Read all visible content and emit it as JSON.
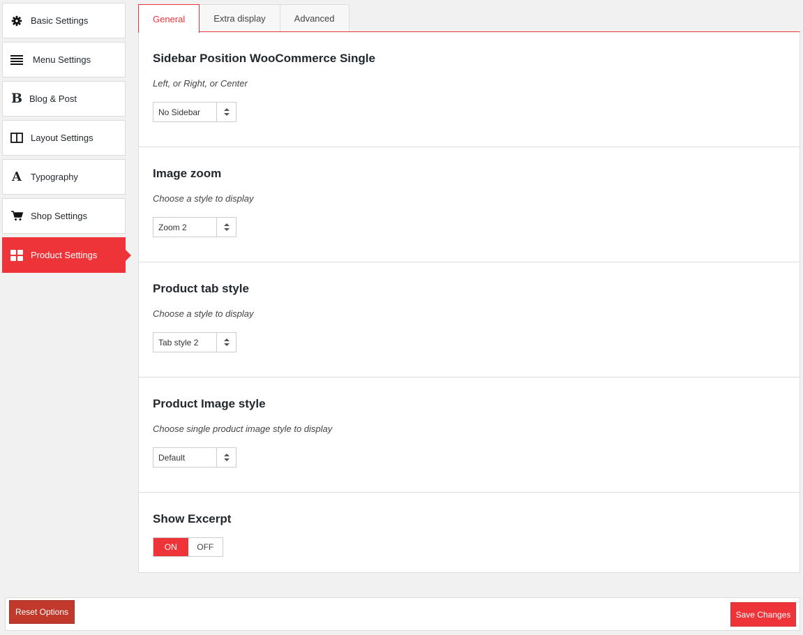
{
  "sidebar": {
    "items": [
      {
        "label": "Basic Settings",
        "icon": "gear-icon"
      },
      {
        "label": "Menu Settings",
        "icon": "list-icon"
      },
      {
        "label": "Blog & Post",
        "icon": "bold-b-icon",
        "glyph": "B"
      },
      {
        "label": "Layout Settings",
        "icon": "columns-icon"
      },
      {
        "label": "Typography",
        "icon": "font-a-icon",
        "glyph": "A"
      },
      {
        "label": "Shop Settings",
        "icon": "cart-icon"
      },
      {
        "label": "Product Settings",
        "icon": "grid-icon",
        "active": true
      }
    ]
  },
  "tabs": [
    {
      "label": "General",
      "active": true
    },
    {
      "label": "Extra display"
    },
    {
      "label": "Advanced"
    }
  ],
  "sections": [
    {
      "title": "Sidebar Position WooCommerce Single",
      "description": "Left, or Right, or Center",
      "select_value": "No Sidebar"
    },
    {
      "title": "Image zoom",
      "description": "Choose a style to display",
      "select_value": "Zoom 2"
    },
    {
      "title": "Product tab style",
      "description": "Choose a style to display",
      "select_value": "Tab style 2"
    },
    {
      "title": "Product Image style",
      "description": "Choose single product image style to display",
      "select_value": "Default"
    },
    {
      "title": "Show Excerpt",
      "toggle_on": "ON",
      "toggle_off": "OFF",
      "toggle_state": "ON"
    }
  ],
  "footer": {
    "reset_label": "Reset Options",
    "save_label": "Save Changes"
  },
  "colors": {
    "accent": "#ee3339",
    "reset": "#c0392b"
  }
}
